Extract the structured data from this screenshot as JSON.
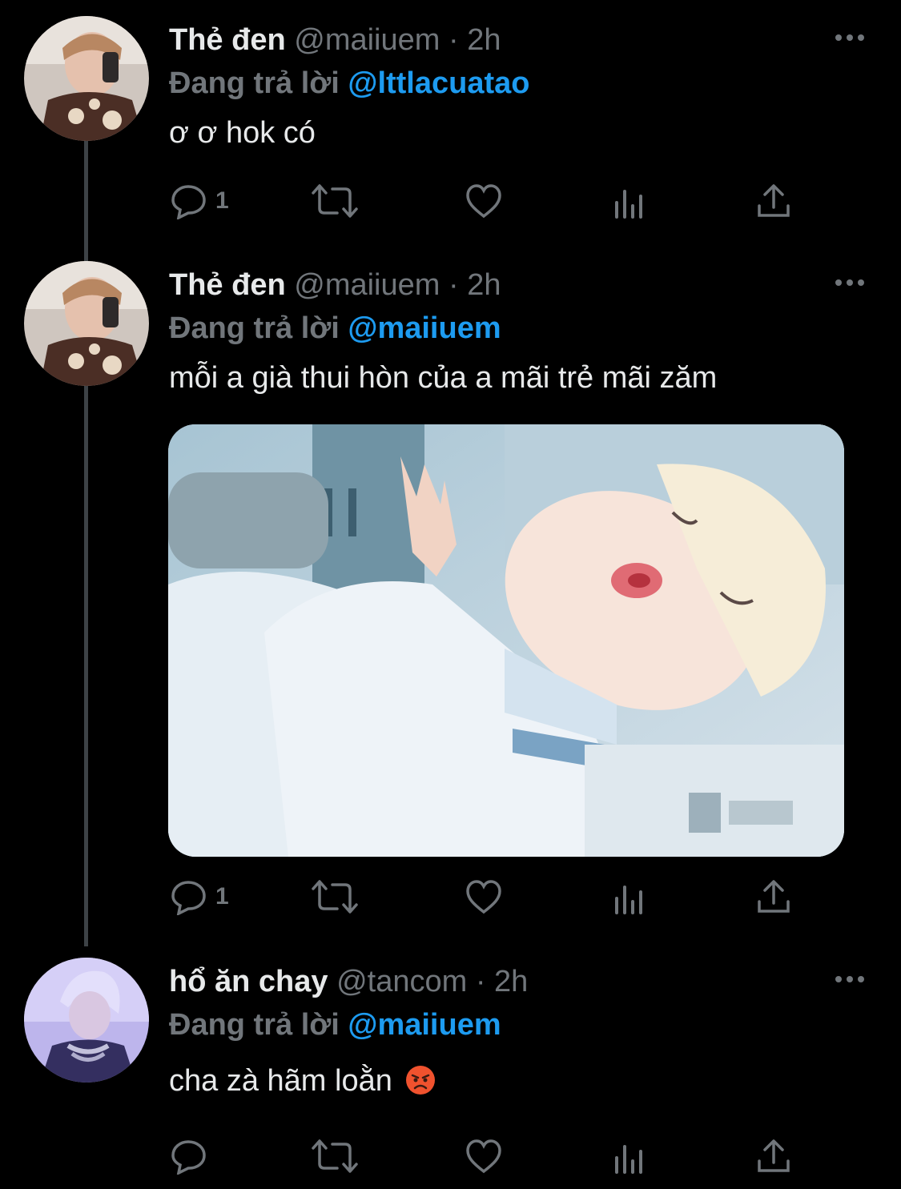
{
  "tweets": [
    {
      "name": "Thẻ đen",
      "handle": "@maiiuem",
      "time": "· 2h",
      "replying_prefix": "Đang trả lời",
      "replying_to": "@lttlacuatao",
      "text": "ơ ơ hok có",
      "reply_count": "1",
      "avatar_icon": "avatar-photo"
    },
    {
      "name": "Thẻ đen",
      "handle": "@maiiuem",
      "time": "· 2h",
      "replying_prefix": "Đang trả lời",
      "replying_to": "@maiiuem",
      "text": "mỗi a già thui hòn của a mãi trẻ mãi zăm",
      "reply_count": "1",
      "avatar_icon": "avatar-photo",
      "has_media": true
    },
    {
      "name": "hổ ăn chay",
      "handle": "@tancom",
      "time": "· 2h",
      "replying_prefix": "Đang trả lời",
      "replying_to": "@maiiuem",
      "text": "cha zà hãm loằn",
      "reply_count": "",
      "avatar_icon": "avatar-photo",
      "emoji_icon": "angry-face-emoji"
    }
  ],
  "colors": {
    "background": "#000000",
    "text": "#e7e9ea",
    "secondary": "#71767b",
    "accent": "#1d9bf0",
    "thread_line": "#3d4246"
  }
}
